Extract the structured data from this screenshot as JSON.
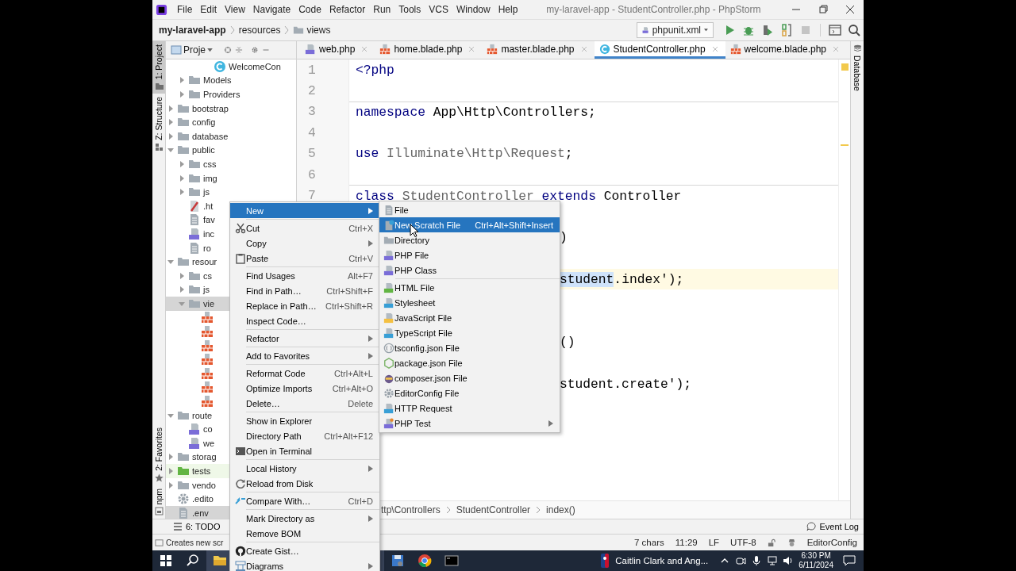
{
  "window": {
    "title": "my-laravel-app - StudentController.php - PhpStorm"
  },
  "menu_bar": [
    "File",
    "Edit",
    "View",
    "Navigate",
    "Code",
    "Refactor",
    "Run",
    "Tools",
    "VCS",
    "Window",
    "Help"
  ],
  "navigation": {
    "breadcrumb": [
      "my-laravel-app",
      "resources",
      "views"
    ],
    "run_config": "phpunit.xml"
  },
  "left_tool_tabs": [
    {
      "label": "1: Project",
      "kind": "project",
      "selected": true
    },
    {
      "label": "Z: Structure",
      "kind": "structure",
      "selected": false
    }
  ],
  "left_tool_tabs_bottom": [
    {
      "label": "2: Favorites",
      "kind": "favorites",
      "selected": false
    },
    {
      "label": "npm",
      "kind": "npm",
      "selected": false
    }
  ],
  "right_tool_tabs": [
    {
      "label": "Database",
      "kind": "database",
      "selected": false
    }
  ],
  "project": {
    "title": "Proje",
    "tree": [
      {
        "children": [
          {
            "children": [
              {
                "children": [
                  {
                    "label": "WelcomeCon",
                    "kind": "class",
                    "selected": false
                  }
                ]
              }
            ]
          },
          {
            "label": "Models",
            "kind": "folder",
            "expanded": false,
            "selected": false
          },
          {
            "label": "Providers",
            "kind": "folder",
            "expanded": false,
            "selected": false
          }
        ]
      },
      {
        "label": "bootstrap",
        "kind": "folder",
        "expanded": false,
        "selected": false
      },
      {
        "label": "config",
        "kind": "folder",
        "expanded": false,
        "selected": false
      },
      {
        "label": "database",
        "kind": "folder",
        "expanded": false,
        "selected": false
      },
      {
        "label": "public",
        "kind": "folder",
        "expanded": true,
        "selected": false,
        "children": [
          {
            "label": "css",
            "kind": "folder",
            "expanded": false,
            "selected": false
          },
          {
            "label": "img",
            "kind": "folder",
            "expanded": false,
            "selected": false
          },
          {
            "label": "js",
            "kind": "folder",
            "expanded": false,
            "selected": false
          },
          {
            "label": ".ht",
            "kind": "htaccess",
            "selected": false
          },
          {
            "label": "fav",
            "kind": "text",
            "selected": false
          },
          {
            "label": "inc",
            "kind": "php",
            "selected": false
          },
          {
            "label": "ro",
            "kind": "text",
            "selected": false
          }
        ]
      },
      {
        "label": "resour",
        "kind": "folder",
        "expanded": true,
        "selected": false,
        "children": [
          {
            "label": "cs",
            "kind": "folder",
            "expanded": false,
            "selected": false
          },
          {
            "label": "js",
            "kind": "folder",
            "expanded": false,
            "selected": false
          },
          {
            "label": "vie",
            "kind": "folder",
            "expanded": true,
            "selected": true,
            "children": [
              {
                "kind": "blade",
                "selected": false
              },
              {
                "kind": "blade",
                "selected": false
              },
              {
                "kind": "blade",
                "selected": false
              },
              {
                "kind": "blade",
                "selected": false
              },
              {
                "kind": "blade",
                "selected": false
              },
              {
                "kind": "blade",
                "selected": false
              },
              {
                "kind": "blade",
                "selected": false
              }
            ]
          }
        ]
      },
      {
        "label": "route",
        "kind": "folder",
        "expanded": true,
        "selected": false,
        "children": [
          {
            "label": "co",
            "kind": "php",
            "selected": false
          },
          {
            "label": "we",
            "kind": "php",
            "selected": false
          }
        ]
      },
      {
        "label": "storag",
        "kind": "folder",
        "expanded": false,
        "selected": false
      },
      {
        "label": "tests",
        "kind": "test-folder",
        "expanded": false,
        "selected": false
      },
      {
        "label": "vendo",
        "kind": "folder",
        "expanded": false,
        "selected": false
      },
      {
        "label": ".edito",
        "kind": "config",
        "selected": false
      },
      {
        "label": ".env",
        "kind": "text",
        "selected": true
      }
    ]
  },
  "editor": {
    "tabs": [
      {
        "label": "web.php",
        "kind": "php",
        "selected": false
      },
      {
        "label": "home.blade.php",
        "kind": "blade",
        "selected": false
      },
      {
        "label": "master.blade.php",
        "kind": "blade",
        "selected": false
      },
      {
        "label": "StudentController.php",
        "kind": "class",
        "selected": true
      },
      {
        "label": "welcome.blade.php",
        "kind": "blade",
        "selected": false
      }
    ],
    "lines": [
      {
        "number": "1",
        "kind": "code",
        "current": false,
        "separator": false,
        "segments": [
          {
            "text": "<?php",
            "kind": "keyword"
          }
        ]
      },
      {
        "number": "2",
        "kind": "blank",
        "current": false,
        "separator": false
      },
      {
        "number": "3",
        "kind": "code",
        "current": false,
        "separator": true,
        "segments": [
          {
            "text": "namespace",
            "kind": "keyword"
          },
          {
            "text": " App\\Http\\Controllers;",
            "kind": "plain"
          }
        ]
      },
      {
        "number": "4",
        "kind": "blank",
        "current": false,
        "separator": false
      },
      {
        "number": "5",
        "kind": "code",
        "current": false,
        "separator": false,
        "segments": [
          {
            "text": "use",
            "kind": "keyword"
          },
          {
            "text": " Illuminate\\Http\\Request",
            "kind": "dim"
          },
          {
            "text": ";",
            "kind": "plain"
          }
        ]
      },
      {
        "number": "6",
        "kind": "blank",
        "current": false,
        "separator": false
      },
      {
        "number": "7",
        "kind": "code",
        "current": false,
        "separator": true,
        "segments": [
          {
            "text": "class",
            "kind": "keyword"
          },
          {
            "text": " StudentController",
            "kind": "dim"
          },
          {
            "text": " extends",
            "kind": "keyword"
          },
          {
            "text": " Controller",
            "kind": "plain"
          }
        ]
      },
      {
        "kind": "blank",
        "current": false,
        "separator": false
      },
      {
        "kind": "fragment",
        "current": false,
        "separator": false,
        "segments": [
          {
            "text": ")",
            "kind": "plain"
          }
        ]
      },
      {
        "kind": "blank",
        "current": false,
        "separator": false
      },
      {
        "kind": "fragment",
        "current": true,
        "separator": false,
        "segments": [
          {
            "text": "student",
            "kind": "match"
          },
          {
            "text": ".index');",
            "kind": "plain"
          }
        ]
      },
      {
        "kind": "blank",
        "current": false,
        "separator": false
      },
      {
        "kind": "blank",
        "current": false,
        "separator": false
      },
      {
        "kind": "fragment",
        "current": false,
        "separator": false,
        "segments": [
          {
            "text": "()",
            "kind": "plain"
          }
        ]
      },
      {
        "kind": "blank",
        "current": false,
        "separator": false
      },
      {
        "kind": "fragment",
        "current": false,
        "separator": false,
        "segments": [
          {
            "text": "student.create');",
            "kind": "plain"
          }
        ]
      }
    ],
    "breadcrumb": [
      "ttp\\Controllers",
      "StudentController",
      "index()"
    ]
  },
  "tool_bar": {
    "left": "6: TODO",
    "right": "Event Log"
  },
  "status_bar": {
    "message": "Creates new scr",
    "items": [
      "7 chars",
      "11:29",
      "LF",
      "UTF-8"
    ],
    "config": "EditorConfig"
  },
  "context_menu": {
    "groups": [
      [
        {
          "label": "New",
          "kind": "none",
          "selected": true,
          "submenu": true
        }
      ],
      [
        {
          "label": "Cut",
          "kind": "cut",
          "shortcut": "Ctrl+X",
          "selected": false,
          "submenu": false
        },
        {
          "label": "Copy",
          "kind": "none",
          "selected": false,
          "submenu": true
        },
        {
          "label": "Paste",
          "kind": "paste",
          "shortcut": "Ctrl+V",
          "selected": false,
          "submenu": false
        }
      ],
      [
        {
          "label": "Find Usages",
          "kind": "none",
          "shortcut": "Alt+F7",
          "selected": false,
          "submenu": false
        },
        {
          "label": "Find in Path…",
          "kind": "none",
          "shortcut": "Ctrl+Shift+F",
          "selected": false,
          "submenu": false
        },
        {
          "label": "Replace in Path…",
          "kind": "none",
          "shortcut": "Ctrl+Shift+R",
          "selected": false,
          "submenu": false
        },
        {
          "label": "Inspect Code…",
          "kind": "none",
          "selected": false,
          "submenu": false
        }
      ],
      [
        {
          "label": "Refactor",
          "kind": "none",
          "selected": false,
          "submenu": true
        }
      ],
      [
        {
          "label": "Add to Favorites",
          "kind": "none",
          "selected": false,
          "submenu": true
        }
      ],
      [
        {
          "label": "Reformat Code",
          "kind": "none",
          "shortcut": "Ctrl+Alt+L",
          "selected": false,
          "submenu": false
        },
        {
          "label": "Optimize Imports",
          "kind": "none",
          "shortcut": "Ctrl+Alt+O",
          "selected": false,
          "submenu": false
        },
        {
          "label": "Delete…",
          "kind": "none",
          "shortcut": "Delete",
          "selected": false,
          "submenu": false
        }
      ],
      [
        {
          "label": "Show in Explorer",
          "kind": "none",
          "selected": false,
          "submenu": false
        },
        {
          "label": "Directory Path",
          "kind": "none",
          "shortcut": "Ctrl+Alt+F12",
          "selected": false,
          "submenu": false
        },
        {
          "label": "Open in Terminal",
          "kind": "terminal",
          "selected": false,
          "submenu": false
        }
      ],
      [
        {
          "label": "Local History",
          "kind": "none",
          "selected": false,
          "submenu": true
        },
        {
          "label": "Reload from Disk",
          "kind": "reload",
          "selected": false,
          "submenu": false
        }
      ],
      [
        {
          "label": "Compare With…",
          "kind": "compare",
          "shortcut": "Ctrl+D",
          "selected": false,
          "submenu": false
        }
      ],
      [
        {
          "label": "Mark Directory as",
          "kind": "none",
          "selected": false,
          "submenu": true
        },
        {
          "label": "Remove BOM",
          "kind": "none",
          "selected": false,
          "submenu": false
        }
      ],
      [
        {
          "label": "Create Gist…",
          "kind": "github",
          "selected": false,
          "submenu": false
        },
        {
          "label": "Diagrams",
          "kind": "diagram",
          "selected": false,
          "submenu": true
        }
      ]
    ]
  },
  "new_submenu": {
    "groups": [
      [
        {
          "label": "File",
          "kind": "text",
          "selected": false,
          "submenu": false
        },
        {
          "label": "New Scratch File",
          "kind": "scratch",
          "shortcut": "Ctrl+Alt+Shift+Insert",
          "selected": true,
          "submenu": false
        },
        {
          "label": "Directory",
          "kind": "folder",
          "selected": false,
          "submenu": false
        },
        {
          "label": "PHP File",
          "kind": "php",
          "selected": false,
          "submenu": false
        },
        {
          "label": "PHP Class",
          "kind": "php",
          "selected": false,
          "submenu": false
        }
      ],
      [
        {
          "label": "HTML File",
          "kind": "html",
          "selected": false,
          "submenu": false
        },
        {
          "label": "Stylesheet",
          "kind": "css",
          "selected": false,
          "submenu": false
        },
        {
          "label": "JavaScript File",
          "kind": "js",
          "selected": false,
          "submenu": false
        },
        {
          "label": "TypeScript File",
          "kind": "ts",
          "selected": false,
          "submenu": false
        },
        {
          "label": "tsconfig.json File",
          "kind": "json",
          "selected": false,
          "submenu": false
        },
        {
          "label": "package.json File",
          "kind": "package",
          "selected": false,
          "submenu": false
        },
        {
          "label": "composer.json File",
          "kind": "composer",
          "selected": false,
          "submenu": false
        },
        {
          "label": "EditorConfig File",
          "kind": "config",
          "selected": false,
          "submenu": false
        },
        {
          "label": "HTTP Request",
          "kind": "api",
          "selected": false,
          "submenu": false
        },
        {
          "label": "PHP Test",
          "kind": "php-test",
          "selected": false,
          "submenu": true
        }
      ]
    ]
  },
  "taskbar": {
    "news": "Caitlin Clark and Ang...",
    "time": "6:30 PM",
    "date": "6/11/2024"
  }
}
